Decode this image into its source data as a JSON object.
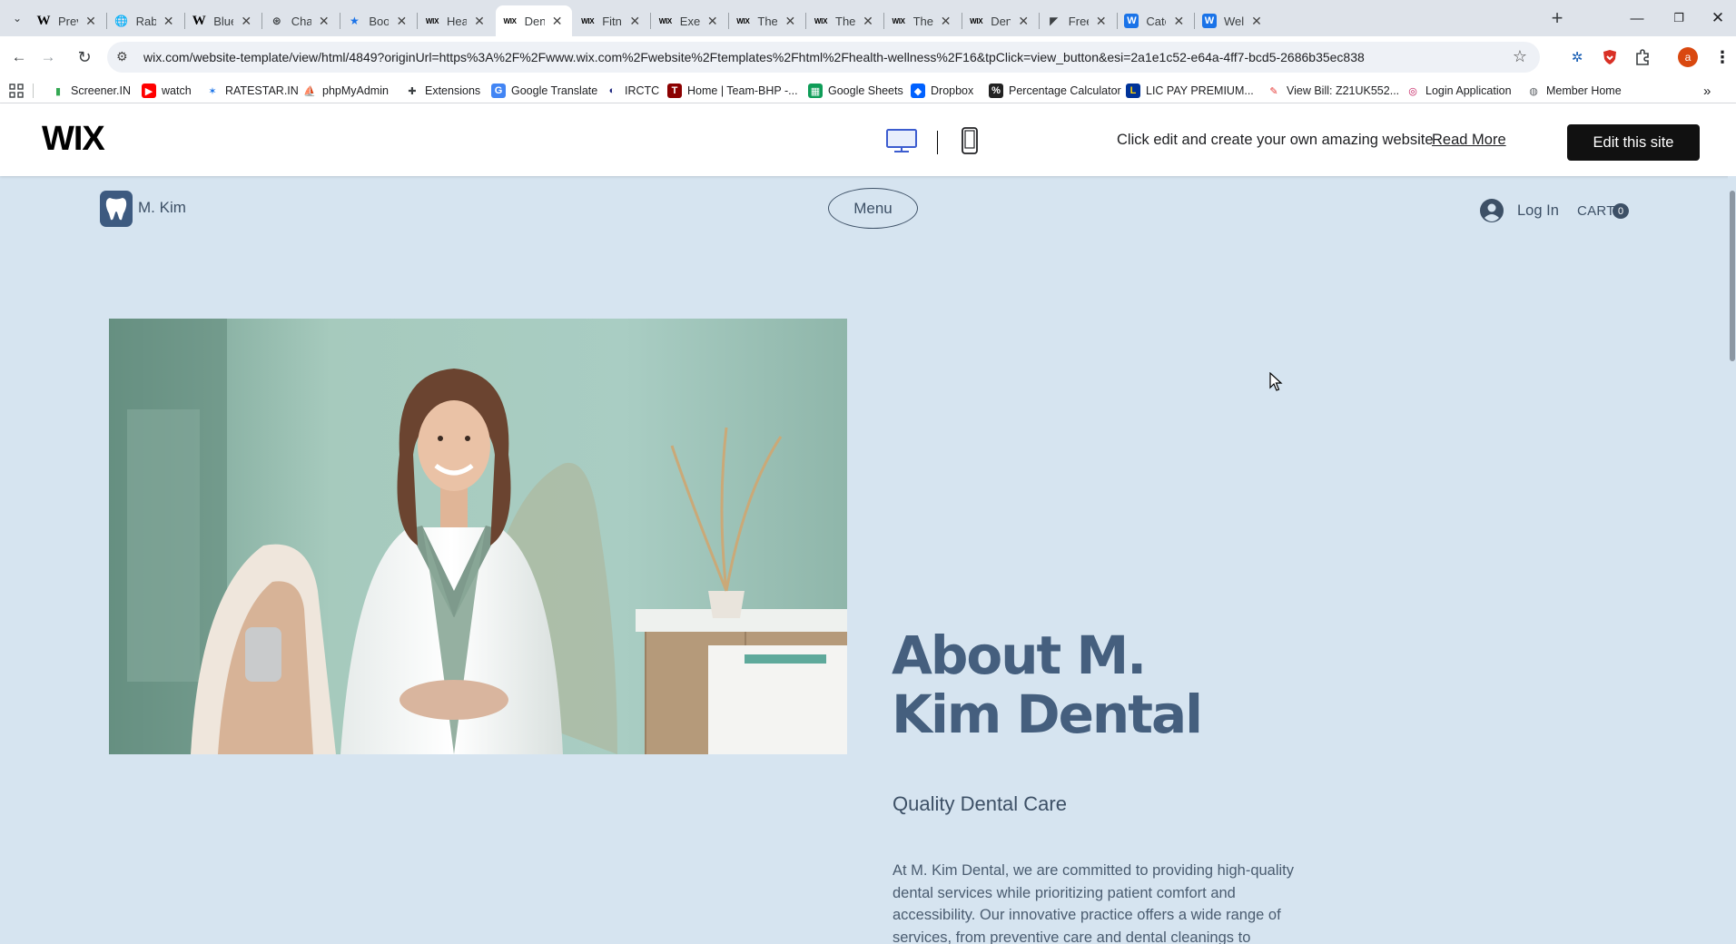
{
  "browser": {
    "tabs": [
      {
        "label": "Preval",
        "icon": "wikipedia-icon"
      },
      {
        "label": "Rabies",
        "icon": "globe-icon"
      },
      {
        "label": "Blue C",
        "icon": "wikipedia-icon"
      },
      {
        "label": "ChatG",
        "icon": "chatgpt-icon"
      },
      {
        "label": "Bookm",
        "icon": "star-icon"
      },
      {
        "label": "Health",
        "icon": "wix-icon"
      },
      {
        "label": "Dentis",
        "icon": "wix-icon",
        "active": true
      },
      {
        "label": "Fitnes",
        "icon": "wix-icon"
      },
      {
        "label": "Exercis",
        "icon": "wix-icon"
      },
      {
        "label": "Thera",
        "icon": "wix-icon"
      },
      {
        "label": "Thera",
        "icon": "wix-icon"
      },
      {
        "label": "Thera",
        "icon": "wix-icon"
      },
      {
        "label": "Dentis",
        "icon": "wix-icon"
      },
      {
        "label": "Free C",
        "icon": "framer-icon"
      },
      {
        "label": "Categ",
        "icon": "wordpress-blue-icon"
      },
      {
        "label": "Wellne",
        "icon": "wordpress-blue-icon"
      }
    ],
    "url": "wix.com/website-template/view/html/4849?originUrl=https%3A%2F%2Fwww.wix.com%2Fwebsite%2Ftemplates%2Fhtml%2Fhealth-wellness%2F16&tpClick=view_button&esi=2a1e1c52-e64a-4ff7-bcd5-2686b35ec838",
    "profile_initial": "a",
    "bookmarks": [
      {
        "label": "Screener.IN",
        "icon": "chart-icon"
      },
      {
        "label": "watch",
        "icon": "youtube-icon"
      },
      {
        "label": "RATESTAR.IN",
        "icon": "ratestar-icon"
      },
      {
        "label": "phpMyAdmin",
        "icon": "phpmyadmin-icon"
      },
      {
        "label": "Extensions",
        "icon": "puzzle-icon"
      },
      {
        "label": "Google Translate",
        "icon": "translate-icon"
      },
      {
        "label": "IRCTC",
        "icon": "irctc-icon"
      },
      {
        "label": "Home | Team-BHP -...",
        "icon": "teambhp-icon"
      },
      {
        "label": "Google Sheets",
        "icon": "sheets-icon"
      },
      {
        "label": "Dropbox",
        "icon": "dropbox-icon"
      },
      {
        "label": "Percentage Calculator",
        "icon": "percent-icon"
      },
      {
        "label": "LIC PAY PREMIUM...",
        "icon": "lic-icon"
      },
      {
        "label": "View Bill: Z21UK552...",
        "icon": "bill-icon"
      },
      {
        "label": "Login Application",
        "icon": "login-icon"
      },
      {
        "label": "Member Home",
        "icon": "member-icon"
      }
    ]
  },
  "wix_bar": {
    "logo": "WIX",
    "message": "Click edit and create your own amazing website",
    "read_more": "Read More",
    "edit_button": "Edit this site"
  },
  "site": {
    "name": "M. Kim",
    "menu_label": "Menu",
    "login_label": "Log In",
    "cart_label": "CART",
    "cart_count": "0",
    "about_title_line1": "About M.",
    "about_title_line2": "Kim Dental",
    "about_subtitle": "Quality Dental Care",
    "about_body": "At M. Kim Dental, we are committed to providing high-quality dental services while prioritizing patient comfort and accessibility. Our innovative practice offers a wide range of services, from preventive care and dental cleanings to"
  },
  "colors": {
    "page_bg": "#d6e4f0",
    "title_blue": "#455f7e",
    "text_slate": "#3d5066",
    "edit_button_bg": "#111111"
  }
}
